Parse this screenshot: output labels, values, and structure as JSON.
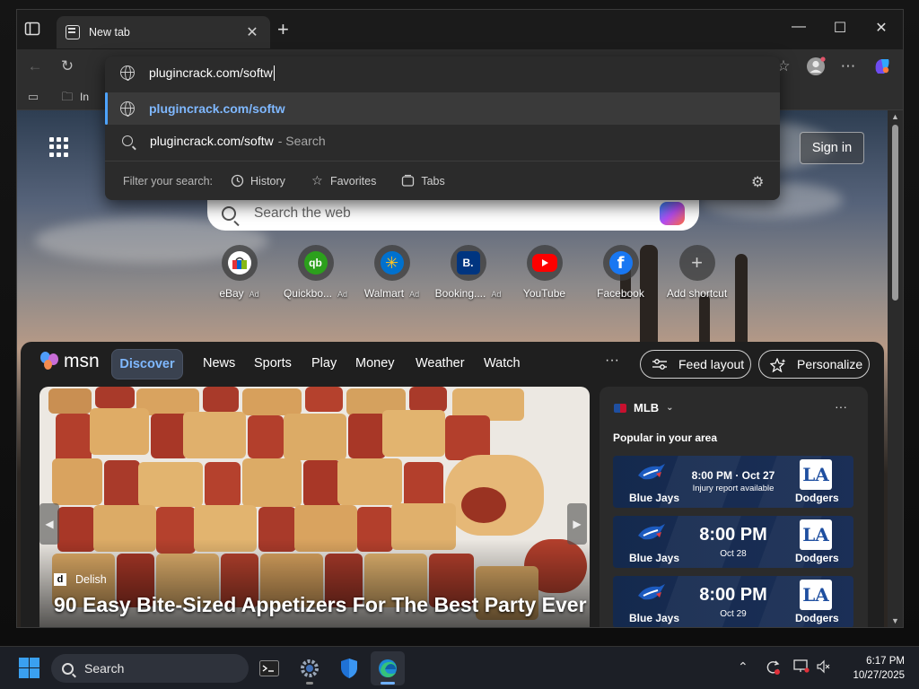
{
  "browser": {
    "tab_title": "New tab",
    "address_input": "plugincrack.com/softw",
    "favorites_bar_partial": "In"
  },
  "omnibox": {
    "suggestion_url": "plugincrack.com/softw",
    "suggestion_search_query": "plugincrack.com/softw",
    "suggestion_search_suffix": "- Search",
    "filter_label": "Filter your search:",
    "filters": [
      "History",
      "Favorites",
      "Tabs"
    ]
  },
  "newtab": {
    "sign_in": "Sign in",
    "search_placeholder": "Search the web",
    "shortcuts": [
      {
        "label": "eBay",
        "ad": "Ad",
        "color": "#ffffff"
      },
      {
        "label": "Quickbo...",
        "ad": "Ad",
        "color": "#2ca01c"
      },
      {
        "label": "Walmart",
        "ad": "Ad",
        "color": "#0071ce"
      },
      {
        "label": "Booking....",
        "ad": "Ad",
        "color": "#003580"
      },
      {
        "label": "YouTube",
        "ad": "",
        "color": "#ff0000"
      },
      {
        "label": "Facebook",
        "ad": "",
        "color": "#1877f2"
      },
      {
        "label": "Add shortcut",
        "ad": "",
        "color": "#777777"
      }
    ]
  },
  "msn": {
    "logo": "msn",
    "nav": [
      "Discover",
      "News",
      "Sports",
      "Play",
      "Money",
      "Weather",
      "Watch"
    ],
    "more": "···",
    "feed_layout": "Feed layout",
    "personalize": "Personalize",
    "hero": {
      "source": "Delish",
      "source_badge": "d",
      "title": "90 Easy Bite-Sized Appetizers For The Best Party Ever"
    },
    "mlb": {
      "league": "MLB",
      "subtitle": "Popular in your area",
      "games": [
        {
          "away": "Blue Jays",
          "home": "Dodgers",
          "time": "8:00 PM · Oct 27",
          "note": "Injury report available",
          "style": "small"
        },
        {
          "away": "Blue Jays",
          "home": "Dodgers",
          "time": "8:00 PM",
          "note": "Oct 28",
          "style": "big"
        },
        {
          "away": "Blue Jays",
          "home": "Dodgers",
          "time": "8:00 PM",
          "note": "Oct 29",
          "style": "big"
        }
      ],
      "home_logo_text": "LA"
    }
  },
  "taskbar": {
    "search_label": "Search",
    "time": "6:17 PM",
    "date": "10/27/2025"
  },
  "colors": {
    "accent": "#4da3ff",
    "discover_text": "#7fb8ff",
    "mlb_card": "#14294d"
  }
}
